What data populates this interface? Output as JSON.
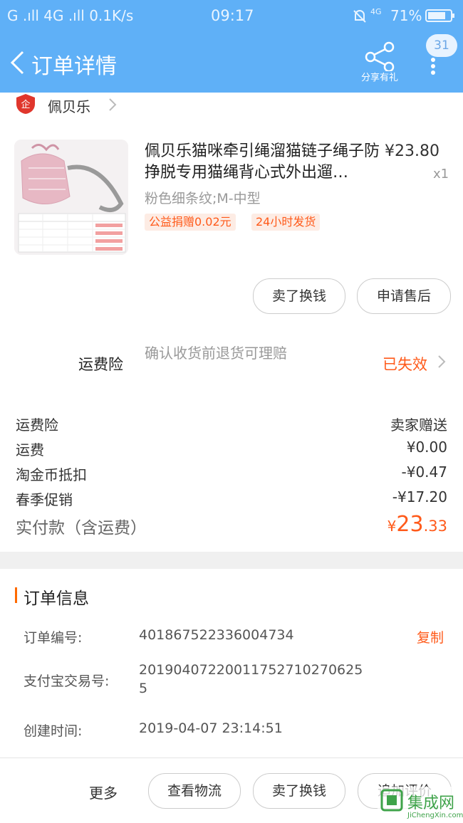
{
  "status_bar": {
    "left": "G .ıll 4G .ıll 0.1K/s",
    "time": "09:17",
    "signal": "4G",
    "battery": "71%"
  },
  "header": {
    "title": "订单详情",
    "share_label": "分享有礼",
    "badge": "31"
  },
  "shop": {
    "name": "佩贝乐"
  },
  "product": {
    "title": "佩贝乐猫咪牵引绳溜猫链子绳子防挣脱专用猫绳背心式外出遛…",
    "price": "¥23.80",
    "qty": "x1",
    "sku": "粉色细条纹;M-中型",
    "tags": [
      "公益捐赠0.02元",
      "24小时发货"
    ],
    "buttons": [
      "卖了换钱",
      "申请售后"
    ]
  },
  "freight_insurance": {
    "label": "运费险",
    "desc": "确认收货前退货可理赔",
    "status": "已失效"
  },
  "costs": [
    {
      "label": "运费险",
      "value": "卖家赠送"
    },
    {
      "label": "运费",
      "value": "¥0.00"
    },
    {
      "label": "淘金币抵扣",
      "value": "-¥0.47"
    },
    {
      "label": "春季促销",
      "value": "-¥17.20"
    }
  ],
  "paid": {
    "label": "实付款（含运费）",
    "currency": "¥",
    "integer": "23",
    "decimal": ".33"
  },
  "order_info": {
    "title": "订单信息",
    "order_no_label": "订单编号:",
    "order_no": "401867522336004734",
    "copy_label": "复制",
    "alipay_label": "支付宝交易号:",
    "alipay_no": "20190407220011752710270625",
    "alipay_no_cont": "5",
    "created_label": "创建时间:",
    "created": "2019-04-07 23:14:51"
  },
  "bottom_bar": {
    "more": "更多",
    "buttons": [
      "查看物流",
      "卖了换钱",
      "追加评价"
    ]
  },
  "watermark": {
    "text": "集成网",
    "sub": "JiChengXin.com"
  },
  "colors": {
    "header_blue": "#5fb0f7",
    "accent_orange": "#ff5a1a",
    "tag_bg": "#fdece4",
    "muted": "#999999"
  }
}
